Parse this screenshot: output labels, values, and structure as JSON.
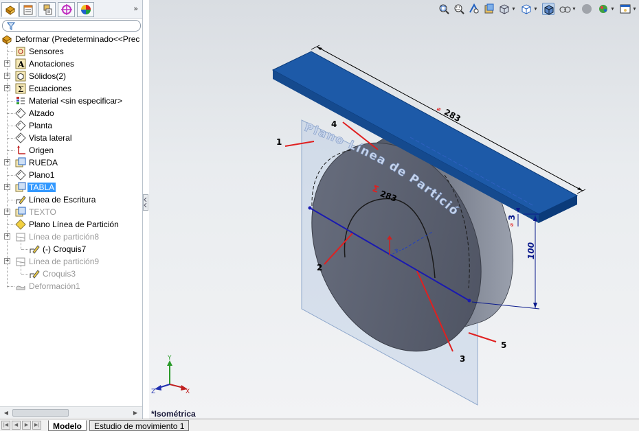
{
  "panel_tabs": [
    "featuremanager-tab",
    "propertymanager-tab",
    "configurationmanager-tab",
    "dimxpert-tab",
    "display-manager-tab"
  ],
  "tabs_more": "»",
  "tree": {
    "root": "Deformar  (Predeterminado<<Prec",
    "items": [
      {
        "label": "Sensores",
        "icon": "sensor-icon",
        "expander": false,
        "dim": false
      },
      {
        "label": "Anotaciones",
        "icon": "annotations-icon",
        "expander": true,
        "dim": false
      },
      {
        "label": "Sólidos(2)",
        "icon": "solid-bodies-icon",
        "expander": true,
        "dim": false
      },
      {
        "label": "Ecuaciones",
        "icon": "equations-icon",
        "expander": true,
        "dim": false
      },
      {
        "label": "Material <sin especificar>",
        "icon": "material-icon",
        "expander": false,
        "dim": false
      },
      {
        "label": "Alzado",
        "icon": "plane-icon",
        "expander": false,
        "dim": false
      },
      {
        "label": "Planta",
        "icon": "plane-icon",
        "expander": false,
        "dim": false
      },
      {
        "label": "Vista lateral",
        "icon": "plane-icon",
        "expander": false,
        "dim": false
      },
      {
        "label": "Origen",
        "icon": "origin-icon",
        "expander": false,
        "dim": false
      },
      {
        "label": "RUEDA",
        "icon": "extrude-icon",
        "expander": true,
        "dim": false
      },
      {
        "label": "Plano1",
        "icon": "plane-icon",
        "expander": false,
        "dim": false
      },
      {
        "label": "TABLA",
        "icon": "extrude-icon",
        "expander": true,
        "dim": false,
        "selected": true
      },
      {
        "label": "Línea de Escritura",
        "icon": "sketch-icon",
        "expander": false,
        "dim": false
      },
      {
        "label": "TEXTO",
        "icon": "extrude-icon",
        "expander": true,
        "dim": true
      },
      {
        "label": "Plano Línea de Partición",
        "icon": "plane-yellow-icon",
        "expander": false,
        "dim": false
      },
      {
        "label": "Línea de partición8",
        "icon": "split-line-icon",
        "expander": true,
        "dim": true
      },
      {
        "label": "(-) Croquis7",
        "icon": "sketch-icon",
        "expander": false,
        "dim": false,
        "child": true
      },
      {
        "label": "Línea de partición9",
        "icon": "split-line-icon",
        "expander": true,
        "dim": true
      },
      {
        "label": "Croquis3",
        "icon": "sketch-icon",
        "expander": false,
        "dim": true,
        "child": true
      },
      {
        "label": "Deformación1",
        "icon": "deform-icon",
        "expander": false,
        "dim": true
      }
    ]
  },
  "bottom_tabs": {
    "model": "Modelo",
    "motion_study": "Estudio de movimiento 1"
  },
  "viewport": {
    "view_name": "*Isométrica",
    "dimensions": {
      "length": "283",
      "arc_text": "283",
      "thickness": "3",
      "height": "100"
    },
    "dim_prefix_length": "⌀",
    "dim_prefix_arc": "Σ",
    "dim_prefix_thickness": "⌀",
    "plane_text": "Plano Línea de Partición",
    "callouts": [
      "1",
      "2",
      "3",
      "4",
      "5"
    ],
    "triad": {
      "x": "X",
      "y": "Y",
      "z": "Z"
    }
  },
  "hud_icons": [
    "zoom-to-fit-icon",
    "zoom-area-icon",
    "previous-view-icon",
    "section-view-icon",
    "view-orientation-icon",
    "display-style-icon",
    "shaded-edges-icon",
    "hide-show-icon",
    "edit-appearance-icon",
    "apply-scene-icon",
    "view-settings-icon"
  ],
  "colors": {
    "board_top": "#1d5aa8",
    "board_edge": "#0b3b7a",
    "wheel_face": "#5d6372",
    "wheel_side": "#6e7482",
    "plane_fill": "#aac0e0",
    "dimension": "#0a1a8c",
    "callout": "#e02020",
    "selection": "#3399ff"
  }
}
